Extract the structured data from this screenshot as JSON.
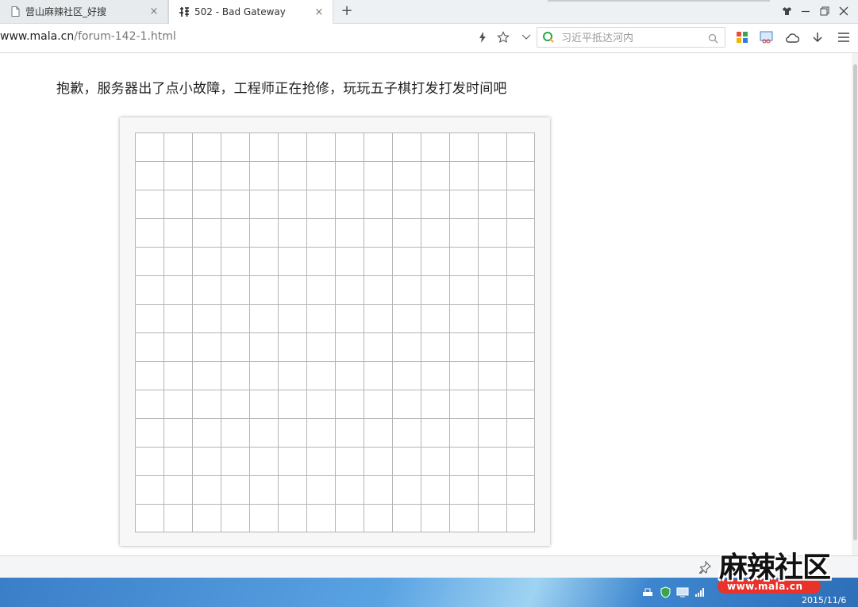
{
  "tabs": [
    {
      "label": "营山麻辣社区_好搜",
      "icon": "page-icon",
      "close": "×"
    },
    {
      "label": "502 - Bad Gateway",
      "icon": "site-favicon",
      "close": "×"
    }
  ],
  "new_tab": "+",
  "address": {
    "host": "www.mala.cn",
    "path": "/forum-142-1.html"
  },
  "search": {
    "placeholder": "习近平抵达河内"
  },
  "page": {
    "message": "抱歉，服务器出了点小故障，工程师正在抢修，玩玩五子棋打发打发时间吧"
  },
  "board": {
    "cells": 14,
    "line_color": "#b5b5b5"
  },
  "watermark": {
    "title": "麻辣社区",
    "url": "www.mala.cn"
  },
  "taskbar": {
    "date": "2015/11/6"
  }
}
